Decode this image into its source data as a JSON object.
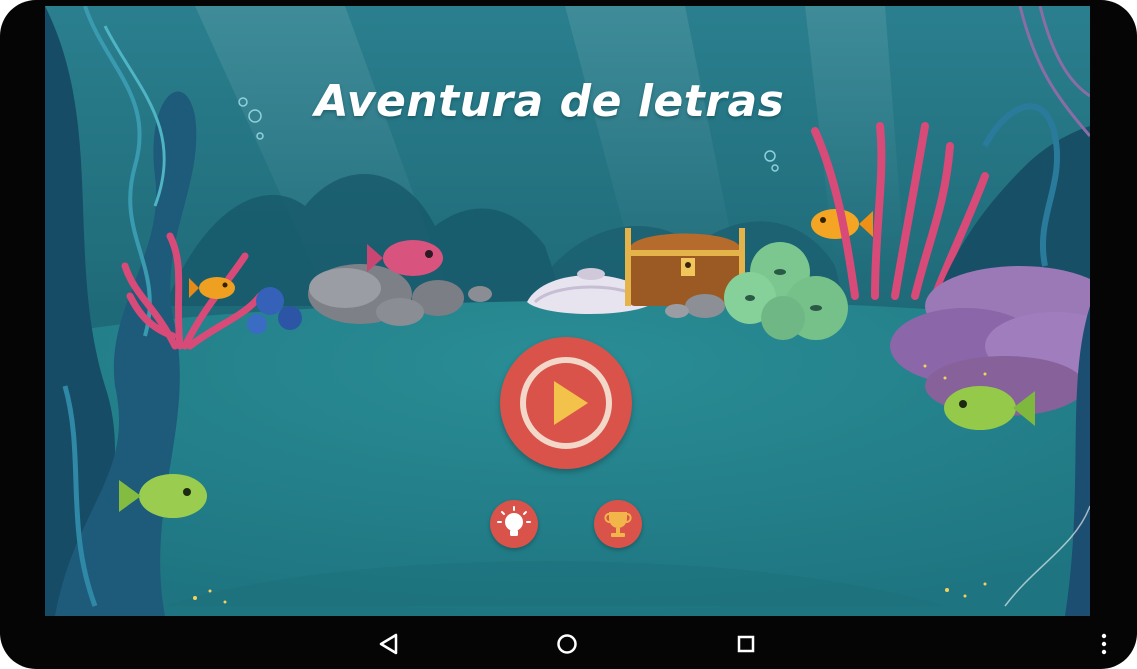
{
  "game": {
    "title": "Aventura de letras"
  },
  "menu": {
    "play_icon": "play-icon",
    "hint_icon": "lightbulb-icon",
    "trophy_icon": "trophy-icon"
  },
  "navbar": {
    "back_icon": "back-triangle-icon",
    "home_icon": "home-circle-icon",
    "recent_icon": "recent-apps-square-icon",
    "menu_icon": "overflow-menu-icon"
  },
  "colors": {
    "button_red": "#d9534a",
    "play_yellow": "#f3c24a",
    "water_teal": "#1f6f7c"
  }
}
